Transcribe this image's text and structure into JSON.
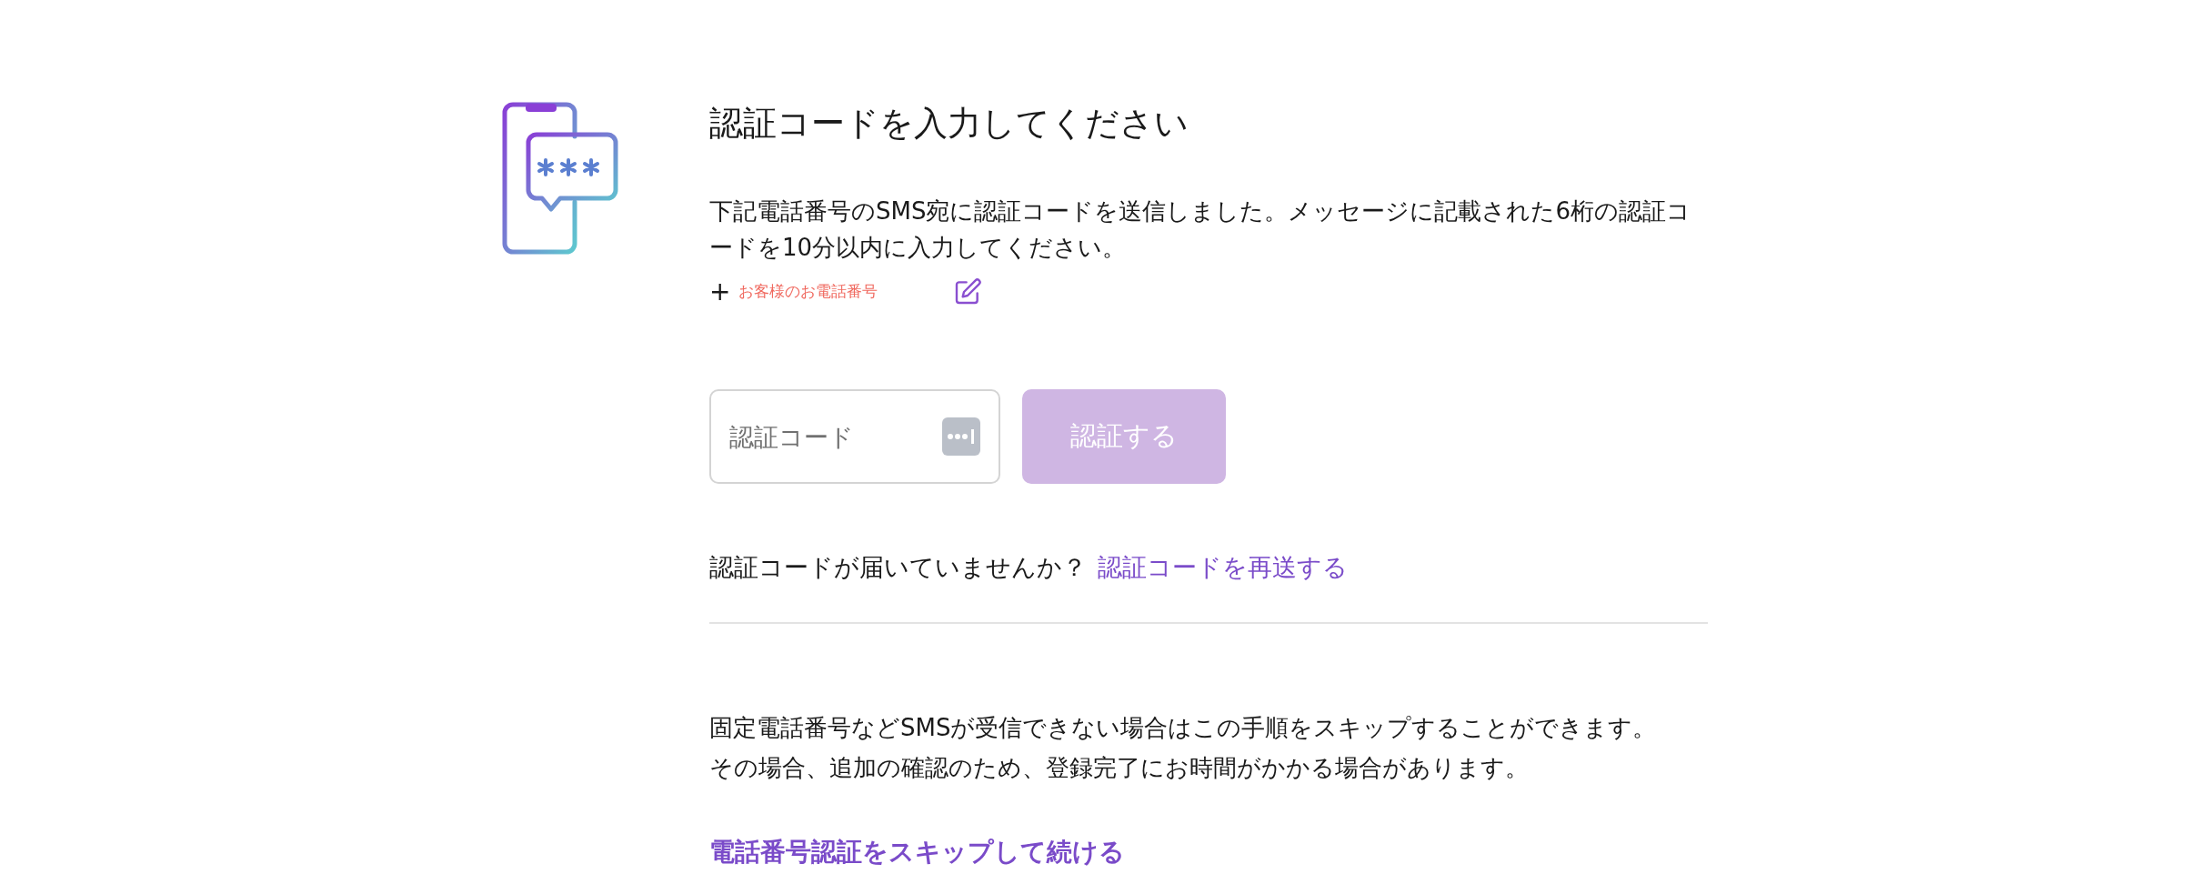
{
  "title": "認証コードを入力してください",
  "description": "下記電話番号のSMS宛に認証コードを送信しました。メッセージに記載された6桁の認証コードを10分以内に入力してください。",
  "phone": {
    "prefix": "+",
    "number": "お客様のお電話番号"
  },
  "code_field": {
    "placeholder": "認証コード"
  },
  "verify_button": {
    "label": "認証する",
    "disabled": true
  },
  "resend": {
    "prompt": "認証コードが届いていませんか？",
    "link": "認証コードを再送する"
  },
  "skip_note": [
    "固定電話番号などSMSが受信できない場合はこの手順をスキップすることができます。",
    "その場合、追加の確認のため、登録完了にお時間がかかる場合があります。"
  ],
  "skip_link": "電話番号認証をスキップして続ける"
}
